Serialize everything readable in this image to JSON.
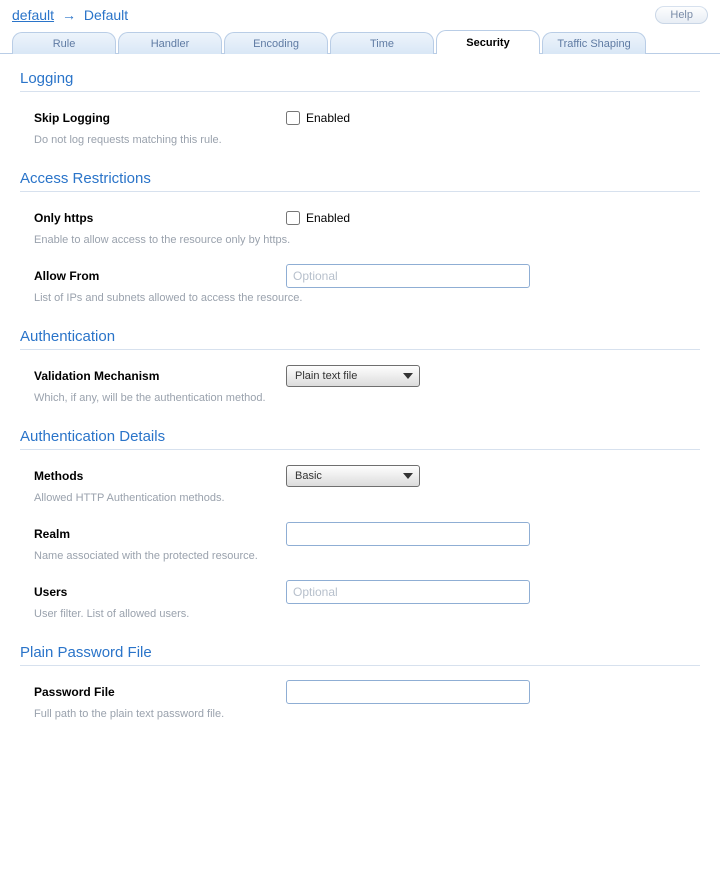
{
  "breadcrumb": {
    "root": "default",
    "arrow": "→",
    "current": "Default"
  },
  "help_label": "Help",
  "tabs": [
    {
      "label": "Rule"
    },
    {
      "label": "Handler"
    },
    {
      "label": "Encoding"
    },
    {
      "label": "Time"
    },
    {
      "label": "Security"
    },
    {
      "label": "Traffic Shaping"
    }
  ],
  "sections": {
    "logging": {
      "title": "Logging",
      "skip_logging": {
        "label": "Skip Logging",
        "enabled_text": "Enabled",
        "help": "Do not log requests matching this rule."
      }
    },
    "access": {
      "title": "Access Restrictions",
      "only_https": {
        "label": "Only https",
        "enabled_text": "Enabled",
        "help": "Enable to allow access to the resource only by https."
      },
      "allow_from": {
        "label": "Allow From",
        "placeholder": "Optional",
        "value": "",
        "help": "List of IPs and subnets allowed to access the resource."
      }
    },
    "auth": {
      "title": "Authentication",
      "mechanism": {
        "label": "Validation Mechanism",
        "selected": "Plain text file",
        "help": "Which, if any, will be the authentication method."
      }
    },
    "auth_details": {
      "title": "Authentication Details",
      "methods": {
        "label": "Methods",
        "selected": "Basic",
        "help": "Allowed HTTP Authentication methods."
      },
      "realm": {
        "label": "Realm",
        "value": "",
        "placeholder": "",
        "help": "Name associated with the protected resource."
      },
      "users": {
        "label": "Users",
        "value": "",
        "placeholder": "Optional",
        "help": "User filter. List of allowed users."
      }
    },
    "passfile": {
      "title": "Plain Password File",
      "password_file": {
        "label": "Password File",
        "value": "",
        "placeholder": "",
        "help": "Full path to the plain text password file."
      }
    }
  }
}
